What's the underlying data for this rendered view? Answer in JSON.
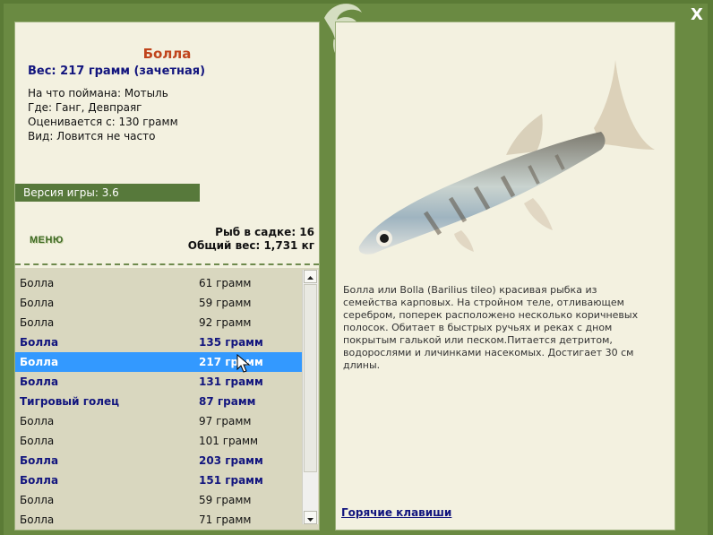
{
  "fish": {
    "title": "Болла",
    "weight_line": "Вес: 217 грамм (зачетная)",
    "bait": "На что поймана: Мотыль",
    "place": "Где: Ганг, Девпраяг",
    "valued": "Оценивается с: 130 грамм",
    "kind": "Вид: Ловится не часто"
  },
  "version": "Версия игры: 3.6",
  "menu_label": "МЕНЮ",
  "stats": {
    "fish_count": "Рыб в садке: 16",
    "total_weight": "Общий вес: 1,731 кг"
  },
  "catch_list": [
    {
      "name": "Болла",
      "weight": "61 грамм",
      "style": "normal"
    },
    {
      "name": "Болла",
      "weight": "59 грамм",
      "style": "normal"
    },
    {
      "name": "Болла",
      "weight": "92 грамм",
      "style": "normal"
    },
    {
      "name": "Болла",
      "weight": "135 грамм",
      "style": "bold"
    },
    {
      "name": "Болла",
      "weight": "217 грамм",
      "style": "selected"
    },
    {
      "name": "Болла",
      "weight": "131 грамм",
      "style": "bold"
    },
    {
      "name": "Тигровый голец",
      "weight": "87 грамм",
      "style": "bold"
    },
    {
      "name": "Болла",
      "weight": "97 грамм",
      "style": "normal"
    },
    {
      "name": "Болла",
      "weight": "101 грамм",
      "style": "normal"
    },
    {
      "name": "Болла",
      "weight": "203 грамм",
      "style": "bold"
    },
    {
      "name": "Болла",
      "weight": "151 грамм",
      "style": "bold"
    },
    {
      "name": "Болла",
      "weight": "59 грамм",
      "style": "normal"
    },
    {
      "name": "Болла",
      "weight": "71 грамм",
      "style": "normal"
    }
  ],
  "description": "Болла или Bolla (Barilius tileo) красивая рыбка из семейства карповых. На стройном теле, отливающем серебром, поперек расположено несколько коричневых полосок. Обитает в быстрых ручьях и реках с дном покрытым галькой или песком.Питается детритом, водорослями и личинками насекомых. Достигает 30 см длины.",
  "hotkeys_label": "Горячие клавиши",
  "close_label": "X",
  "colors": {
    "frame": "#5b7b36",
    "panel": "#f3f1e0",
    "title": "#c0441c",
    "bold_text": "#12157e",
    "selected_bg": "#3399ff",
    "list_bg": "#d9d7bf"
  },
  "icons": [
    "leaf-logo-icon",
    "close-icon",
    "scroll-up-icon",
    "scroll-down-icon",
    "mouse-cursor-icon"
  ]
}
